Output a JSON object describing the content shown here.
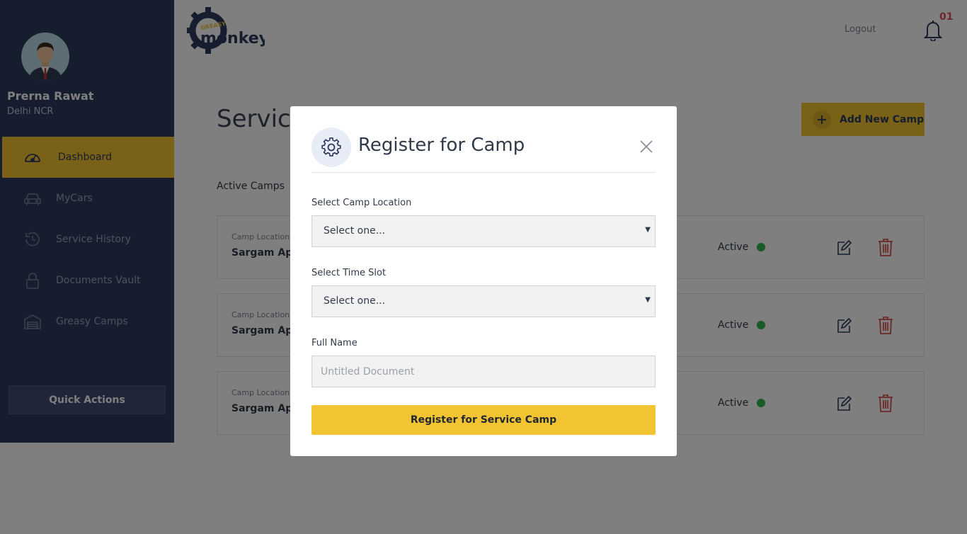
{
  "user": {
    "name": "Prerna Rawat",
    "location": "Delhi NCR"
  },
  "sidebar": {
    "items": [
      {
        "label": "Dashboard",
        "icon": "speedometer-icon",
        "active": true
      },
      {
        "label": "MyCars",
        "icon": "car-icon",
        "active": false
      },
      {
        "label": "Service History",
        "icon": "history-icon",
        "active": false
      },
      {
        "label": "Documents Vault",
        "icon": "lock-icon",
        "active": false
      },
      {
        "label": "Greasy Camps",
        "icon": "garage-icon",
        "active": false
      }
    ],
    "quick_actions_label": "Quick Actions"
  },
  "header": {
    "logo_top": "GREASY",
    "logo_main": "monkey",
    "logout_label": "Logout",
    "notification_count": "01"
  },
  "main": {
    "page_title": "Service",
    "add_camp_label": "Add New Camp",
    "section_label": "Active Camps",
    "camps": [
      {
        "location_label": "Camp Location",
        "location": "Sargam Apa",
        "status": "Active"
      },
      {
        "location_label": "Camp Location",
        "location": "Sargam Apa",
        "status": "Active"
      },
      {
        "location_label": "Camp Location",
        "location": "Sargam Apa",
        "status": "Active"
      }
    ]
  },
  "modal": {
    "title": "Register for Camp",
    "location_label": "Select Camp Location",
    "location_value": "Select one...",
    "timeslot_label": "Select Time Slot",
    "timeslot_value": "Select one...",
    "fullname_label": "Full Name",
    "fullname_placeholder": "Untitled Document",
    "submit_label": "Register for Service Camp"
  },
  "colors": {
    "sidebar_bg": "#2d3a5c",
    "accent": "#f3c431",
    "status_active": "#2fb84a",
    "delete": "#d9534f"
  }
}
